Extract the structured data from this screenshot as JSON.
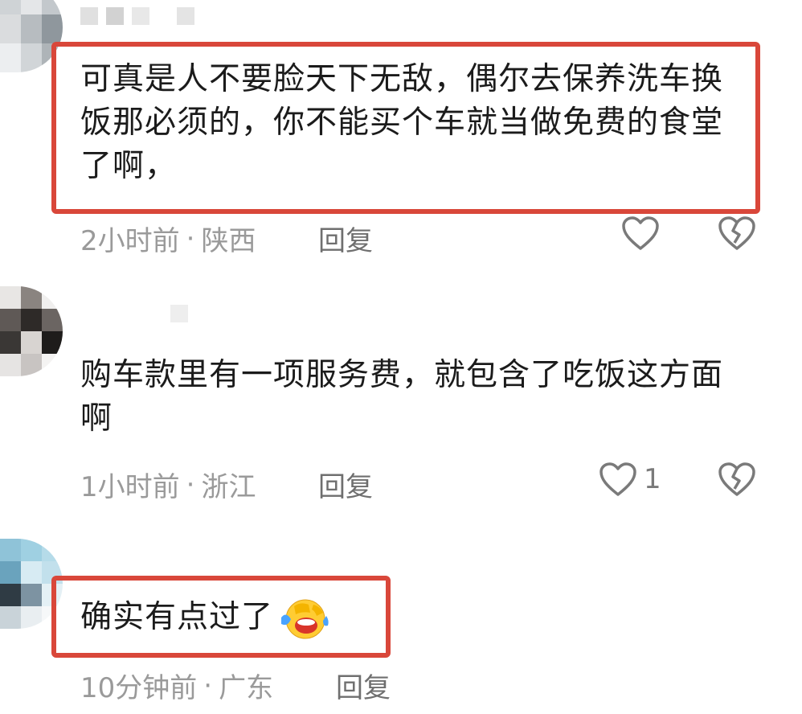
{
  "comments": [
    {
      "text": "可真是人不要脸天下无敌，偶尔去保养洗车换饭那必须的，你不能买个车就当做免费的食堂了啊，",
      "time": "2小时前",
      "location": "陕西",
      "reply_label": "回复",
      "like_count": ""
    },
    {
      "text": "购车款里有一项服务费，就包含了吃饭这方面啊",
      "time": "1小时前",
      "location": "浙江",
      "reply_label": "回复",
      "like_count": "1"
    },
    {
      "text": "确实有点过了",
      "time": "10分钟前",
      "location": "广东",
      "reply_label": "回复",
      "like_count": ""
    }
  ],
  "separator": "·",
  "colors": {
    "highlight_border": "#d9473a",
    "meta_text": "#9a9a9a",
    "reply_text": "#6f6f6f"
  },
  "icons": {
    "like": "heart-outline-icon",
    "dislike": "broken-heart-icon",
    "emoji": "laughing-tears-emoji"
  }
}
